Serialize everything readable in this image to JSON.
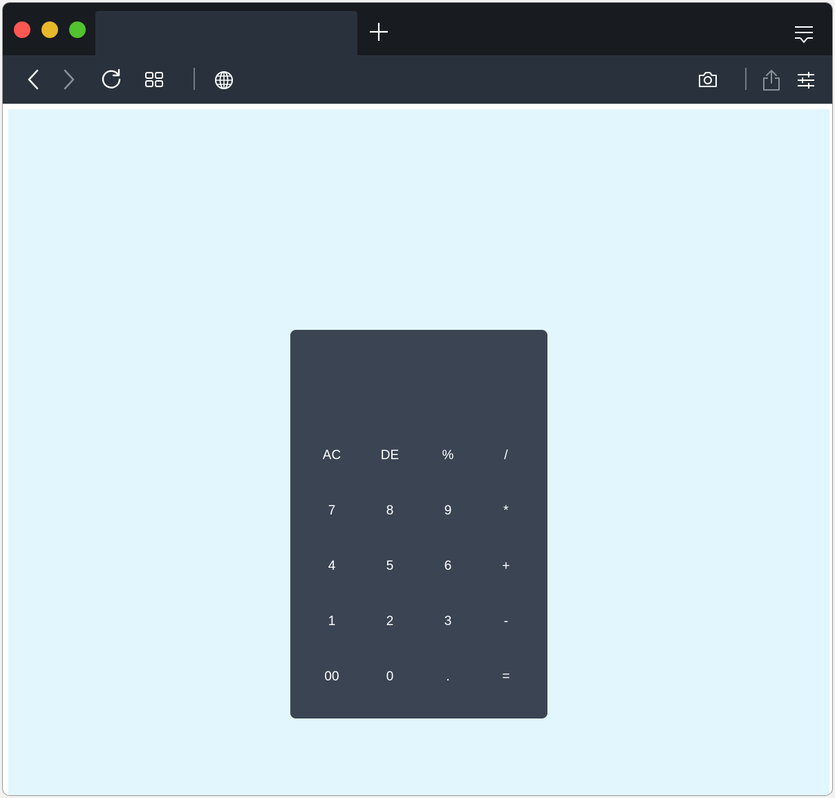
{
  "browser": {
    "tab_title": "",
    "icons": {
      "new_tab": "plus-icon",
      "menu": "tab-list-icon",
      "back": "chevron-left-icon",
      "forward": "chevron-right-icon",
      "reload": "reload-icon",
      "tabs_overview": "grid-icon",
      "site": "globe-icon",
      "screenshot": "camera-icon",
      "share": "share-icon",
      "settings": "sliders-icon"
    },
    "colors": {
      "titlebar": "#181b20",
      "toolbar": "#29323c",
      "close": "#fd5752",
      "minimize": "#e6b92a",
      "maximize": "#52c22f"
    }
  },
  "page": {
    "background": "#e2f6fe"
  },
  "calculator": {
    "display": "",
    "panel_color": "#3a4452",
    "keys": [
      [
        "AC",
        "DE",
        "%",
        "/"
      ],
      [
        "7",
        "8",
        "9",
        "*"
      ],
      [
        "4",
        "5",
        "6",
        "+"
      ],
      [
        "1",
        "2",
        "3",
        "-"
      ],
      [
        "00",
        "0",
        ".",
        "="
      ]
    ]
  }
}
